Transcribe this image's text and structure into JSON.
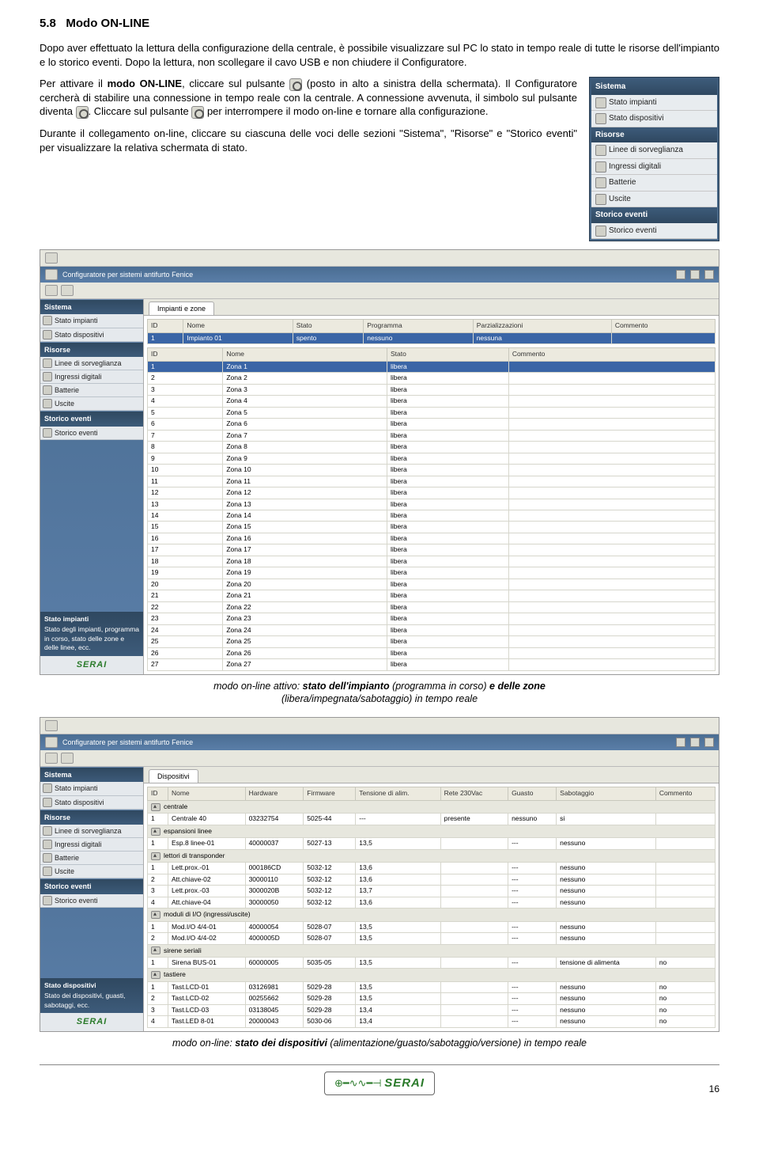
{
  "section": {
    "num": "5.8",
    "title": "Modo ON-LINE"
  },
  "p1": "Dopo aver effettuato la lettura della configurazione della centrale, è possibile visualizzare sul PC lo stato in tempo reale di tutte le risorse dell'impianto e lo storico eventi. Dopo la lettura, non scollegare il cavo USB e non chiudere il Configuratore.",
  "p2_a": "Per attivare il ",
  "p2_b": "modo ON-LINE",
  "p2_c": ", cliccare sul pulsante ",
  "p2_d": " (posto in alto a sinistra della schermata). Il Configuratore cercherà di stabilire una connessione in tempo reale con la centrale. A connessione avvenuta, il simbolo sul pulsante diventa ",
  "p2_e": ". Cliccare sul pulsante ",
  "p2_f": " per interrompere il modo on-line e tornare alla configurazione.",
  "p3": "Durante il collegamento on-line, cliccare su ciascuna delle voci delle sezioni \"Sistema\", \"Risorse\" e \"Storico eventi\" per visualizzare la relativa schermata di stato.",
  "panel": {
    "sistema": {
      "head": "Sistema",
      "items": [
        "Stato impianti",
        "Stato dispositivi"
      ]
    },
    "risorse": {
      "head": "Risorse",
      "items": [
        "Linee di sorveglianza",
        "Ingressi digitali",
        "Batterie",
        "Uscite"
      ]
    },
    "storico": {
      "head": "Storico eventi",
      "items": [
        "Storico eventi"
      ]
    }
  },
  "shot1": {
    "title": "Configuratore per sistemi antifurto Fenice",
    "tab": "Impianti e zone",
    "hdr1": [
      "ID",
      "Nome",
      "Stato",
      "Programma",
      "Parzializzazioni",
      "Commento"
    ],
    "row1": [
      "1",
      "Impianto 01",
      "spento",
      "nessuno",
      "nessuna",
      ""
    ],
    "hdr2": [
      "ID",
      "Nome",
      "Stato",
      "Commento"
    ],
    "zones": [
      [
        "1",
        "Zona 1",
        "libera",
        ""
      ],
      [
        "2",
        "Zona 2",
        "libera",
        ""
      ],
      [
        "3",
        "Zona 3",
        "libera",
        ""
      ],
      [
        "4",
        "Zona 4",
        "libera",
        ""
      ],
      [
        "5",
        "Zona 5",
        "libera",
        ""
      ],
      [
        "6",
        "Zona 6",
        "libera",
        ""
      ],
      [
        "7",
        "Zona 7",
        "libera",
        ""
      ],
      [
        "8",
        "Zona 8",
        "libera",
        ""
      ],
      [
        "9",
        "Zona 9",
        "libera",
        ""
      ],
      [
        "10",
        "Zona 10",
        "libera",
        ""
      ],
      [
        "11",
        "Zona 11",
        "libera",
        ""
      ],
      [
        "12",
        "Zona 12",
        "libera",
        ""
      ],
      [
        "13",
        "Zona 13",
        "libera",
        ""
      ],
      [
        "14",
        "Zona 14",
        "libera",
        ""
      ],
      [
        "15",
        "Zona 15",
        "libera",
        ""
      ],
      [
        "16",
        "Zona 16",
        "libera",
        ""
      ],
      [
        "17",
        "Zona 17",
        "libera",
        ""
      ],
      [
        "18",
        "Zona 18",
        "libera",
        ""
      ],
      [
        "19",
        "Zona 19",
        "libera",
        ""
      ],
      [
        "20",
        "Zona 20",
        "libera",
        ""
      ],
      [
        "21",
        "Zona 21",
        "libera",
        ""
      ],
      [
        "22",
        "Zona 22",
        "libera",
        ""
      ],
      [
        "23",
        "Zona 23",
        "libera",
        ""
      ],
      [
        "24",
        "Zona 24",
        "libera",
        ""
      ],
      [
        "25",
        "Zona 25",
        "libera",
        ""
      ],
      [
        "26",
        "Zona 26",
        "libera",
        ""
      ],
      [
        "27",
        "Zona 27",
        "libera",
        ""
      ]
    ],
    "info_title": "Stato impianti",
    "info_text": "Stato degli impianti, programma in corso, stato delle zone e delle linee, ecc."
  },
  "caption1_a": "modo on-line attivo: ",
  "caption1_b": "stato dell'impianto",
  "caption1_c": " (programma in corso) ",
  "caption1_d": "e delle zone",
  "caption1_e": " (libera/impegnata/sabotaggio) in tempo reale",
  "shot2": {
    "title": "Configuratore per sistemi antifurto Fenice",
    "tab": "Dispositivi",
    "hdr": [
      "ID",
      "Nome",
      "Hardware",
      "Firmware",
      "Tensione di alim.",
      "Rete 230Vac",
      "Guasto",
      "Sabotaggio",
      "Commento"
    ],
    "groups": [
      {
        "name": "centrale",
        "rows": [
          [
            "1",
            "Centrale 40",
            "03232754",
            "5025-44",
            "---",
            "presente",
            "nessuno",
            "si",
            ""
          ]
        ]
      },
      {
        "name": "espansioni linee",
        "rows": [
          [
            "1",
            "Esp.8 linee-01",
            "40000037",
            "5027-13",
            "13,5",
            "",
            "---",
            "nessuno",
            ""
          ]
        ]
      },
      {
        "name": "lettori di transponder",
        "rows": [
          [
            "1",
            "Lett.prox.-01",
            "000186CD",
            "5032-12",
            "13,6",
            "",
            "---",
            "nessuno",
            ""
          ],
          [
            "2",
            "Att.chiave-02",
            "30000110",
            "5032-12",
            "13,6",
            "",
            "---",
            "nessuno",
            ""
          ],
          [
            "3",
            "Lett.prox.-03",
            "3000020B",
            "5032-12",
            "13,7",
            "",
            "---",
            "nessuno",
            ""
          ],
          [
            "4",
            "Att.chiave-04",
            "30000050",
            "5032-12",
            "13,6",
            "",
            "---",
            "nessuno",
            ""
          ]
        ]
      },
      {
        "name": "moduli di I/O (ingressi/uscite)",
        "rows": [
          [
            "1",
            "Mod.I/O 4/4-01",
            "40000054",
            "5028-07",
            "13,5",
            "",
            "---",
            "nessuno",
            ""
          ],
          [
            "2",
            "Mod.I/O 4/4-02",
            "4000005D",
            "5028-07",
            "13,5",
            "",
            "---",
            "nessuno",
            ""
          ]
        ]
      },
      {
        "name": "sirene seriali",
        "rows": [
          [
            "1",
            "Sirena BUS-01",
            "60000005",
            "5035-05",
            "13,5",
            "",
            "---",
            "tensione di alimenta",
            "no"
          ]
        ]
      },
      {
        "name": "tastiere",
        "rows": [
          [
            "1",
            "Tast.LCD-01",
            "03126981",
            "5029-28",
            "13,5",
            "",
            "---",
            "nessuno",
            "no"
          ],
          [
            "2",
            "Tast.LCD-02",
            "00255662",
            "5029-28",
            "13,5",
            "",
            "---",
            "nessuno",
            "no"
          ],
          [
            "3",
            "Tast.LCD-03",
            "03138045",
            "5029-28",
            "13,4",
            "",
            "---",
            "nessuno",
            "no"
          ],
          [
            "4",
            "Tast.LED 8-01",
            "20000043",
            "5030-06",
            "13,4",
            "",
            "---",
            "nessuno",
            "no"
          ]
        ]
      }
    ],
    "info_title": "Stato dispositivi",
    "info_text": "Stato dei dispositivi, guasti, sabotaggi, ecc."
  },
  "caption2_a": "modo on-line: ",
  "caption2_b": "stato dei dispositivi",
  "caption2_c": " (alimentazione/guasto/sabotaggio/versione) in tempo reale",
  "footer": {
    "logo": "SERAI",
    "page": "16"
  }
}
